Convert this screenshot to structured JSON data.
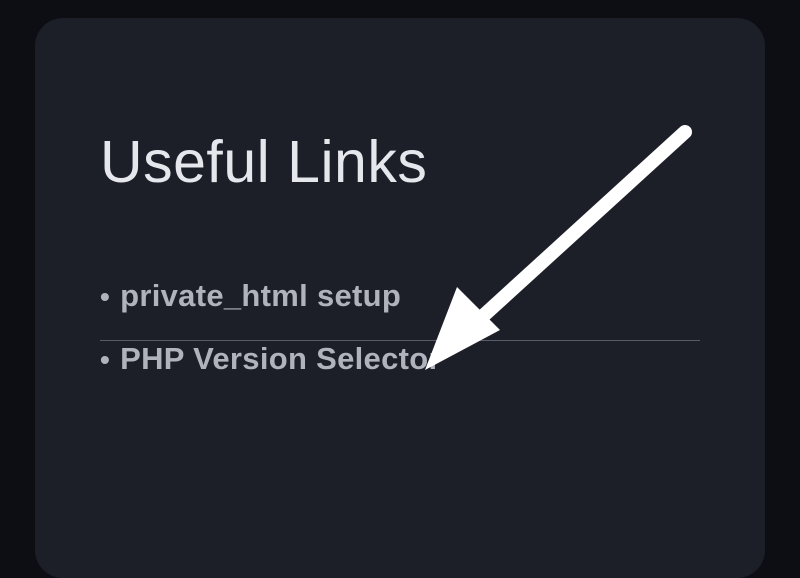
{
  "panel": {
    "title": "Useful Links",
    "links": [
      {
        "label": "private_html setup"
      },
      {
        "label": "PHP Version Selector"
      }
    ]
  }
}
